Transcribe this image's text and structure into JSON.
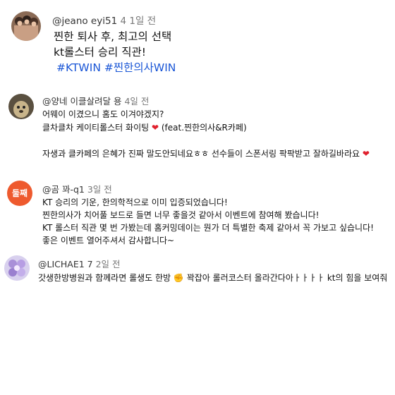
{
  "comments": [
    {
      "user": "@jeano  eyi51",
      "time": "4 1일 전",
      "lines": [
        "찐한 퇴사 후, 최고의 선택",
        "kt롤스터 승리 직관!"
      ],
      "hashtags": "#KTWIN #찐한의사WIN"
    },
    {
      "user": "@양네  이클살려달  용",
      "time": "4일 전",
      "lines": [
        "어웨이 이겼으니 홈도 이겨야겠지?",
        "클차클차 케이티롤스터 화이팅",
        "(feat.찐한의사&R카페)",
        "자생과 클카페의 은혜가 진짜 말도안되네요ㅎㅎ 선수들이 스폰서링 팍팍받고 잘하길바라요"
      ]
    },
    {
      "user": "@곰  꽈-q1",
      "time": "3일 전",
      "avatar_text": "둘째",
      "lines": [
        "KT 승리의 기운, 한의학적으로 이미 입증되었습니다!",
        "찐한의사가 치어풀 보드로 들면 너무 좋을것 같아서 이벤트에 참여해 봤습니다!",
        "KT 롤스터 직관 몇 번 가봤는데 홈커밍데이는 뭔가 더 특별한 축제 같아서 꼭 가보고 싶습니다!",
        "좋은 이벤트 열어주셔서 감사합니다~"
      ]
    },
    {
      "user": "@LICHAE1  7",
      "time": "2일 전",
      "lines": [
        "갓생한방병원과 함께라면 롤생도 한방",
        "꽉잡아 롤러코스터 올라간다아ㅏㅏㅏㅏ kt의 힘을 보여줘"
      ]
    }
  ],
  "icons": {
    "heart": "heart-icon",
    "fist": "fist-icon"
  },
  "colors": {
    "hashtag": "#1a56d6",
    "heart": "#e0202d",
    "avatar3": "#ee5a2e"
  }
}
